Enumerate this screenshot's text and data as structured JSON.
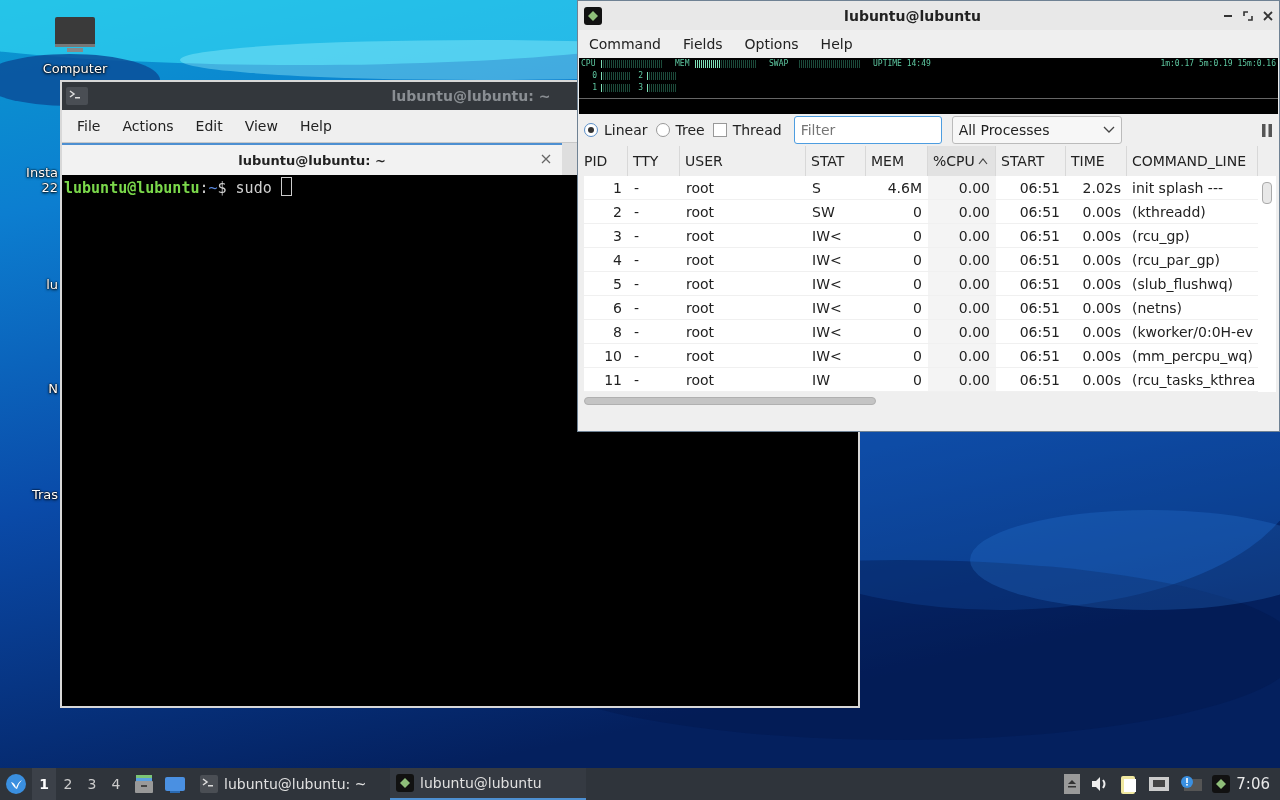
{
  "desktop": {
    "icons": [
      {
        "kind": "computer",
        "lines": [
          "Computer"
        ]
      },
      {
        "kind": "hidden",
        "lines": [
          "Insta",
          "22"
        ]
      },
      {
        "kind": "hidden",
        "lines": [
          "lu"
        ]
      },
      {
        "kind": "hidden",
        "lines": [
          "N"
        ]
      },
      {
        "kind": "hidden",
        "lines": [
          "Tras"
        ]
      }
    ]
  },
  "terminal": {
    "title": "lubuntu@lubuntu: ~",
    "menu": [
      "File",
      "Actions",
      "Edit",
      "View",
      "Help"
    ],
    "tabs": [
      {
        "label": "lubuntu@lubuntu: ~",
        "selected": true
      }
    ],
    "prompt": {
      "user_host": "lubuntu@lubuntu",
      "separator": ":",
      "path": "~",
      "symbol": "$",
      "command": "sudo"
    }
  },
  "process_viewer": {
    "title": "lubuntu@lubuntu",
    "menu": [
      "Command",
      "Fields",
      "Options",
      "Help"
    ],
    "monitor": {
      "meters": [
        {
          "label": "CPU",
          "level": 0.04
        },
        {
          "label": "MEM",
          "level": 0.42
        },
        {
          "label": "SWAP",
          "level": 0
        }
      ],
      "uptime": "UPTIME 14:49",
      "cores": [
        {
          "label": "0",
          "level": 0.05
        },
        {
          "label": "2",
          "level": 0.05
        },
        {
          "label": "1",
          "level": 0.05
        },
        {
          "label": "3",
          "level": 0.05
        }
      ],
      "load": "1m:0.17 5m:0.19 15m:0.16"
    },
    "view_modes": [
      {
        "label": "Linear",
        "selected": true
      },
      {
        "label": "Tree",
        "selected": false
      }
    ],
    "thread": {
      "label": "Thread",
      "checked": false
    },
    "filter": {
      "placeholder": "Filter"
    },
    "process_filter": {
      "value": "All Processes"
    },
    "columns": [
      {
        "label": "PID",
        "sorted": false
      },
      {
        "label": "TTY",
        "sorted": false
      },
      {
        "label": "USER",
        "sorted": false
      },
      {
        "label": "STAT",
        "sorted": false
      },
      {
        "label": "MEM",
        "sorted": false
      },
      {
        "label": "%CPU",
        "sorted": true
      },
      {
        "label": "START",
        "sorted": false
      },
      {
        "label": "TIME",
        "sorted": false
      },
      {
        "label": "COMMAND_LINE",
        "sorted": false
      }
    ],
    "rows": [
      [
        "1",
        "-",
        "root",
        "S",
        "4.6M",
        "0.00",
        "06:51",
        "2.02s",
        "init splash ---"
      ],
      [
        "2",
        "-",
        "root",
        "SW",
        "0",
        "0.00",
        "06:51",
        "0.00s",
        "(kthreadd)"
      ],
      [
        "3",
        "-",
        "root",
        "IW<",
        "0",
        "0.00",
        "06:51",
        "0.00s",
        "(rcu_gp)"
      ],
      [
        "4",
        "-",
        "root",
        "IW<",
        "0",
        "0.00",
        "06:51",
        "0.00s",
        "(rcu_par_gp)"
      ],
      [
        "5",
        "-",
        "root",
        "IW<",
        "0",
        "0.00",
        "06:51",
        "0.00s",
        "(slub_flushwq)"
      ],
      [
        "6",
        "-",
        "root",
        "IW<",
        "0",
        "0.00",
        "06:51",
        "0.00s",
        "(netns)"
      ],
      [
        "8",
        "-",
        "root",
        "IW<",
        "0",
        "0.00",
        "06:51",
        "0.00s",
        "(kworker/0:0H-ev"
      ],
      [
        "10",
        "-",
        "root",
        "IW<",
        "0",
        "0.00",
        "06:51",
        "0.00s",
        "(mm_percpu_wq)"
      ],
      [
        "11",
        "-",
        "root",
        "IW",
        "0",
        "0.00",
        "06:51",
        "0.00s",
        "(rcu_tasks_kthrea"
      ]
    ]
  },
  "taskbar": {
    "desktops": [
      {
        "label": "1",
        "selected": true
      },
      {
        "label": "2",
        "selected": false
      },
      {
        "label": "3",
        "selected": false
      },
      {
        "label": "4",
        "selected": false
      }
    ],
    "tasks": [
      {
        "kind": "terminal",
        "label": "lubuntu@lubuntu: ~",
        "selected": false
      },
      {
        "kind": "monitor",
        "label": "lubuntu@lubuntu",
        "selected": true
      }
    ],
    "clock": "7:06"
  }
}
